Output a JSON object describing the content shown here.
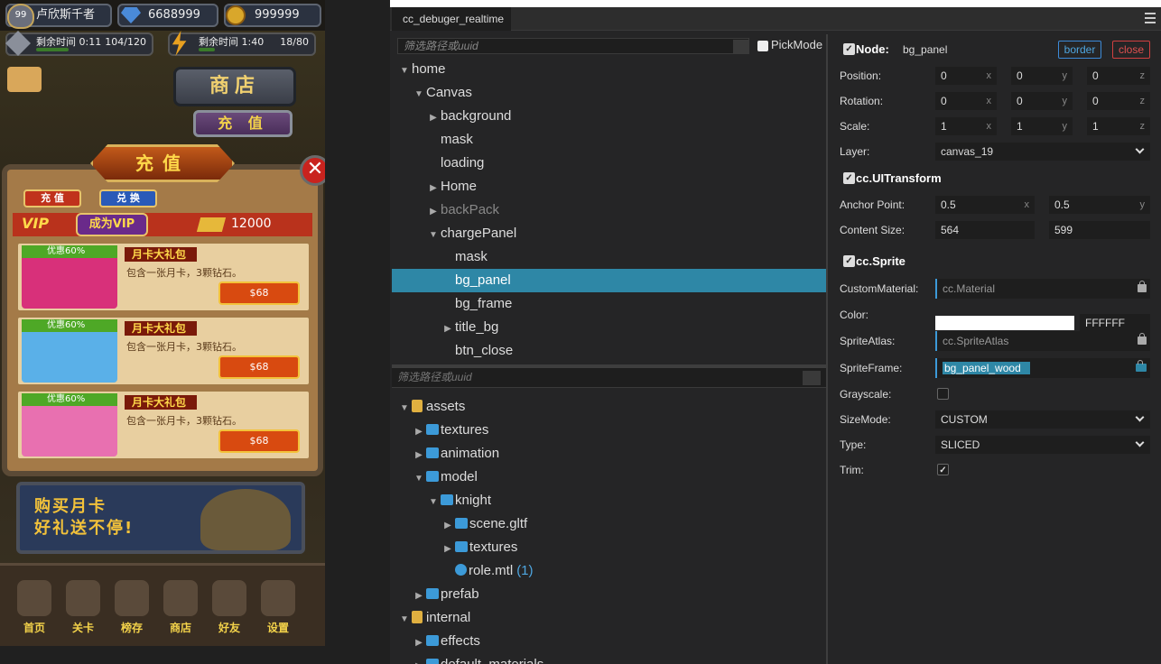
{
  "game": {
    "player_name": "卢欣斯千者",
    "level": "99",
    "gems": "6688999",
    "coins": "999999",
    "energy1": {
      "label": "剩余时间",
      "time": "0:11",
      "count": "104/120",
      "fill_fraction": 0.4
    },
    "energy2": {
      "label": "剩余时间",
      "time": "1:40",
      "count": "18/80",
      "fill_fraction": 0.2
    },
    "shop_sign": "商店",
    "recharge_button": "充 值",
    "panel_title": "充值",
    "close_glyph": "✕",
    "tab_recharge": "充 值",
    "tab_exchange": "兑 换",
    "vip_label": "VIP",
    "become_vip": "成为VIP",
    "vip_amount": "12000",
    "items": [
      {
        "discount": "优惠60%",
        "title": "月卡大礼包",
        "desc": "包含一张月卡，3颗钻石。",
        "price": "$68",
        "color": "#d8307a"
      },
      {
        "discount": "优惠60%",
        "title": "月卡大礼包",
        "desc": "包含一张月卡，3颗钻石。",
        "price": "$68",
        "color": "#5ab0e8"
      },
      {
        "discount": "优惠60%",
        "title": "月卡大礼包",
        "desc": "包含一张月卡，3颗钻石。",
        "price": "$68",
        "color": "#e870b0"
      }
    ],
    "banner_line1": "购买月卡",
    "banner_line2": "好礼送不停!",
    "nav": [
      "首页",
      "关卡",
      "榜存",
      "商店",
      "好友",
      "设置"
    ]
  },
  "debugger": {
    "tab_title": "cc_debuger_realtime",
    "filter_placeholder": "筛选路径或uuid",
    "pickmode_label": "PickMode",
    "tree": [
      {
        "label": "home",
        "arrow": "▼",
        "indent": 0
      },
      {
        "label": "Canvas",
        "arrow": "▼",
        "indent": 1
      },
      {
        "label": "background",
        "arrow": "▶",
        "indent": 2
      },
      {
        "label": "mask",
        "arrow": "",
        "indent": 2
      },
      {
        "label": "loading",
        "arrow": "",
        "indent": 2
      },
      {
        "label": "Home",
        "arrow": "▶",
        "indent": 2
      },
      {
        "label": "backPack",
        "arrow": "▶",
        "indent": 2,
        "dim": true
      },
      {
        "label": "chargePanel",
        "arrow": "▼",
        "indent": 2
      },
      {
        "label": "mask",
        "arrow": "",
        "indent": 3
      },
      {
        "label": "bg_panel",
        "arrow": "",
        "indent": 3,
        "selected": true
      },
      {
        "label": "bg_frame",
        "arrow": "",
        "indent": 3
      },
      {
        "label": "title_bg",
        "arrow": "▶",
        "indent": 3
      },
      {
        "label": "btn_close",
        "arrow": "",
        "indent": 3
      }
    ],
    "assets_filter_placeholder": "筛选路径或uuid",
    "assets": [
      {
        "label": "assets",
        "arrow": "▼",
        "indent": 0,
        "icon": "db"
      },
      {
        "label": "textures",
        "arrow": "▶",
        "indent": 1,
        "icon": "folder"
      },
      {
        "label": "animation",
        "arrow": "▶",
        "indent": 1,
        "icon": "folder"
      },
      {
        "label": "model",
        "arrow": "▼",
        "indent": 1,
        "icon": "folder"
      },
      {
        "label": "knight",
        "arrow": "▼",
        "indent": 2,
        "icon": "folder"
      },
      {
        "label": "scene.gltf",
        "arrow": "▶",
        "indent": 3,
        "icon": "folder"
      },
      {
        "label": "textures",
        "arrow": "▶",
        "indent": 3,
        "icon": "folder"
      },
      {
        "label": "role.mtl",
        "arrow": "",
        "indent": 3,
        "icon": "mtl",
        "count": "(1)"
      },
      {
        "label": "prefab",
        "arrow": "▶",
        "indent": 1,
        "icon": "folder"
      },
      {
        "label": "internal",
        "arrow": "▼",
        "indent": 0,
        "icon": "db"
      },
      {
        "label": "effects",
        "arrow": "▶",
        "indent": 1,
        "icon": "folder"
      },
      {
        "label": "default_materials",
        "arrow": "▶",
        "indent": 1,
        "icon": "folder"
      }
    ],
    "inspector": {
      "node_label": "Node:",
      "node_name": "bg_panel",
      "border_button": "border",
      "close_button": "close",
      "position_label": "Position:",
      "position": [
        "0",
        "0",
        "0"
      ],
      "rotation_label": "Rotation:",
      "rotation": [
        "0",
        "0",
        "0"
      ],
      "scale_label": "Scale:",
      "scale": [
        "1",
        "1",
        "1"
      ],
      "axes": [
        "x",
        "y",
        "z"
      ],
      "layer_label": "Layer:",
      "layer": "canvas_19",
      "uitransform_title": "cc.UITransform",
      "anchor_label": "Anchor Point:",
      "anchor": [
        "0.5",
        "0.5"
      ],
      "content_label": "Content Size:",
      "content": [
        "564",
        "599"
      ],
      "sprite_title": "cc.Sprite",
      "custom_material_label": "CustomMaterial:",
      "custom_material": "cc.Material",
      "color_label": "Color:",
      "color_hex": "FFFFFF",
      "sprite_atlas_label": "SpriteAtlas:",
      "sprite_atlas": "cc.SpriteAtlas",
      "sprite_frame_label": "SpriteFrame:",
      "sprite_frame": "bg_panel_wood",
      "grayscale_label": "Grayscale:",
      "sizemode_label": "SizeMode:",
      "sizemode": "CUSTOM",
      "type_label": "Type:",
      "type": "SLICED",
      "trim_label": "Trim:",
      "check_glyph": "✓"
    }
  }
}
